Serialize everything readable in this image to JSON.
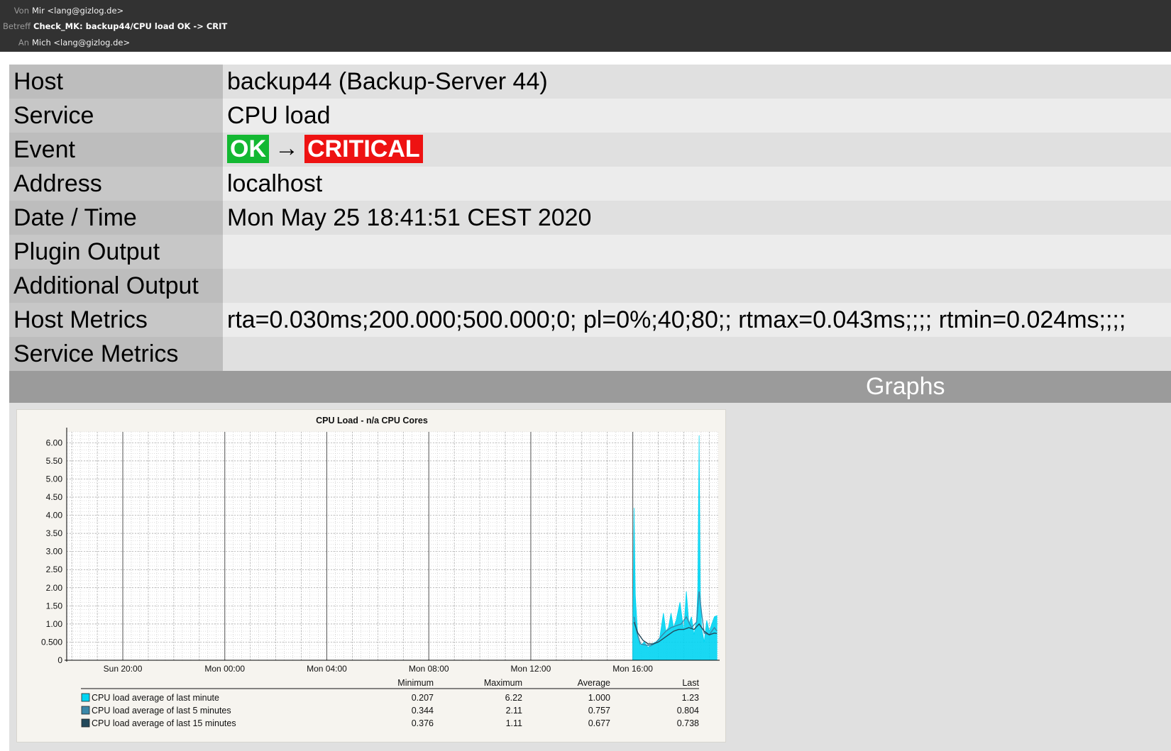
{
  "mail": {
    "from_label": "Von",
    "from_value": "Mir <lang@gizlog.de>",
    "subject_label": "Betreff",
    "subject_value": "Check_MK: backup44/CPU load OK -> CRIT",
    "to_label": "An",
    "to_value": "Mich <lang@gizlog.de>"
  },
  "info": {
    "host_label": "Host",
    "host_value": "backup44 (Backup-Server 44)",
    "service_label": "Service",
    "service_value": "CPU load",
    "event_label": "Event",
    "event_from": "OK",
    "event_arrow": "→",
    "event_to": "CRITICAL",
    "address_label": "Address",
    "address_value": "localhost",
    "datetime_label": "Date / Time",
    "datetime_value": "Mon May 25 18:41:51 CEST 2020",
    "plugin_output_label": "Plugin Output",
    "plugin_output_value": "",
    "additional_output_label": "Additional Output",
    "additional_output_value": "",
    "host_metrics_label": "Host Metrics",
    "host_metrics_value": "rta=0.030ms;200.000;500.000;0; pl=0%;40;80;; rtmax=0.043ms;;;; rtmin=0.024ms;;;;",
    "service_metrics_label": "Service Metrics",
    "service_metrics_value": ""
  },
  "graphs": {
    "title": "Graphs"
  },
  "colors": {
    "ok": "#13b832",
    "critical": "#ee1212",
    "series_1min": "#00d4f2",
    "series_5min": "#3a87a8",
    "series_15min": "#22485a"
  },
  "chart_data": {
    "type": "area",
    "title": "CPU Load - n/a CPU Cores",
    "xlabel": "",
    "ylabel": "",
    "ylim": [
      0,
      6.3
    ],
    "yticks": [
      "0",
      "0.500",
      "1.00",
      "1.50",
      "2.00",
      "2.50",
      "3.00",
      "3.50",
      "4.00",
      "4.50",
      "5.00",
      "5.50",
      "6.00"
    ],
    "ytick_values": [
      0,
      0.5,
      1,
      1.5,
      2,
      2.5,
      3,
      3.5,
      4,
      4.5,
      5,
      5.5,
      6
    ],
    "xticks": [
      "Sun 20:00",
      "Mon 00:00",
      "Mon 04:00",
      "Mon 08:00",
      "Mon 12:00",
      "Mon 16:00"
    ],
    "xtick_hours": [
      20,
      24,
      28,
      32,
      36,
      40
    ],
    "xlim_hours": [
      17.8,
      43.35
    ],
    "grid": true,
    "legend_columns": [
      "Minimum",
      "Maximum",
      "Average",
      "Last"
    ],
    "series": [
      {
        "name": "CPU load average of last minute",
        "min": "0.207",
        "max": "6.22",
        "avg": "1.000",
        "last": "1.23",
        "x_hours": [
          40.0,
          40.05,
          40.1,
          40.2,
          40.3,
          40.45,
          40.6,
          40.75,
          40.9,
          41.05,
          41.2,
          41.3,
          41.4,
          41.5,
          41.6,
          41.7,
          41.85,
          42.0,
          42.1,
          42.2,
          42.3,
          42.4,
          42.5,
          42.55,
          42.6,
          42.65,
          42.7,
          42.8,
          42.9,
          43.0,
          43.1,
          43.2,
          43.3
        ],
        "values": [
          0.5,
          4.2,
          1.8,
          0.6,
          0.4,
          0.5,
          0.35,
          0.45,
          0.5,
          0.6,
          1.3,
          0.8,
          0.9,
          1.3,
          0.9,
          1.1,
          1.6,
          0.8,
          1.9,
          1.0,
          1.2,
          0.7,
          1.1,
          2.0,
          6.2,
          1.8,
          0.9,
          0.5,
          1.1,
          0.8,
          1.0,
          1.2,
          1.23
        ]
      },
      {
        "name": "CPU load average of last 5 minutes",
        "min": "0.344",
        "max": "2.11",
        "avg": "0.757",
        "last": "0.804",
        "x_hours": [
          40.05,
          40.15,
          40.3,
          40.5,
          40.7,
          40.9,
          41.1,
          41.3,
          41.5,
          41.7,
          41.9,
          42.1,
          42.3,
          42.5,
          42.6,
          42.7,
          42.8,
          43.0,
          43.2,
          43.3
        ],
        "values": [
          1.2,
          0.8,
          0.45,
          0.42,
          0.4,
          0.48,
          0.65,
          0.8,
          0.9,
          0.95,
          1.0,
          1.2,
          0.9,
          1.05,
          1.9,
          1.3,
          0.75,
          0.7,
          0.9,
          0.804
        ]
      },
      {
        "name": "CPU load average of last 15 minutes",
        "min": "0.376",
        "max": "1.11",
        "avg": "0.677",
        "last": "0.738",
        "x_hours": [
          40.05,
          40.2,
          40.4,
          40.6,
          40.8,
          41.0,
          41.2,
          41.4,
          41.6,
          41.8,
          42.0,
          42.2,
          42.4,
          42.6,
          42.8,
          43.0,
          43.2,
          43.3
        ],
        "values": [
          1.05,
          0.75,
          0.55,
          0.45,
          0.45,
          0.5,
          0.6,
          0.7,
          0.8,
          0.85,
          0.85,
          0.9,
          0.85,
          1.0,
          0.8,
          0.7,
          0.75,
          0.738
        ]
      }
    ]
  }
}
